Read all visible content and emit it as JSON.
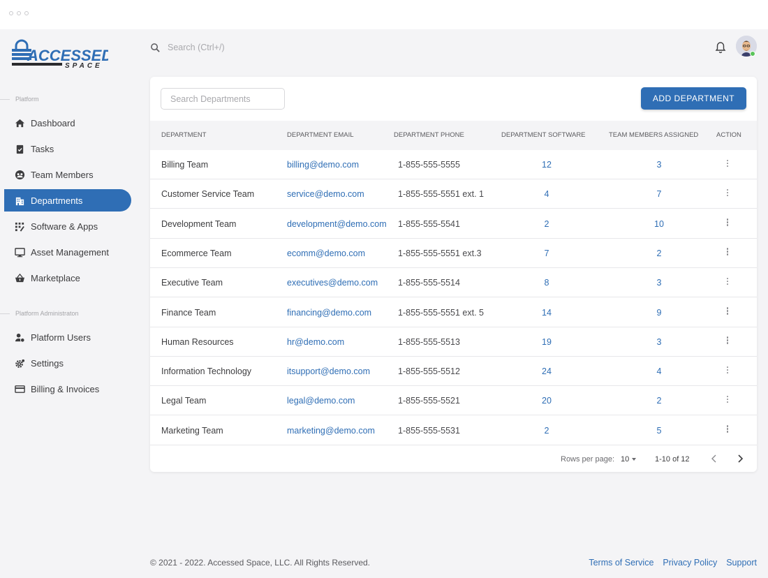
{
  "window": {
    "title": ""
  },
  "brand": {
    "name": "ACCESSED",
    "sub": "SPACE",
    "primary_color": "#2f6eb5",
    "dark_color": "#2b2b2e"
  },
  "sidebar": {
    "sections": [
      {
        "label": "Platform"
      },
      {
        "label": "Platform Administraton"
      }
    ],
    "items": [
      {
        "label": "Dashboard",
        "icon": "home-icon",
        "active": false
      },
      {
        "label": "Tasks",
        "icon": "clipboard-icon",
        "active": false
      },
      {
        "label": "Team Members",
        "icon": "team-icon",
        "active": false
      },
      {
        "label": "Departments",
        "icon": "building-icon",
        "active": true
      },
      {
        "label": "Software & Apps",
        "icon": "apps-grid-icon",
        "active": false
      },
      {
        "label": "Asset Management",
        "icon": "monitor-icon",
        "active": false
      },
      {
        "label": "Marketplace",
        "icon": "basket-icon",
        "active": false
      },
      {
        "label": "Platform Users",
        "icon": "users-shield-icon",
        "active": false
      },
      {
        "label": "Settings",
        "icon": "gear-icon",
        "active": false
      },
      {
        "label": "Billing & Invoices",
        "icon": "credit-card-icon",
        "active": false
      }
    ]
  },
  "header": {
    "search_placeholder": "Search (Ctrl+/)",
    "bell_icon": "bell-icon",
    "avatar_status_color": "#5bc45b"
  },
  "card": {
    "search_placeholder": "Search Departments",
    "add_button": "ADD DEPARTMENT",
    "columns": [
      "DEPARTMENT",
      "DEPARTMENT EMAIL",
      "DEPARTMENT PHONE",
      "DEPARTMENT SOFTWARE",
      "TEAM MEMBERS ASSIGNED",
      "ACTION"
    ],
    "rows": [
      {
        "name": "Billing Team",
        "email": "billing@demo.com",
        "phone": "1-855-555-5555",
        "software": "12",
        "members": "3"
      },
      {
        "name": "Customer Service Team",
        "email": "service@demo.com",
        "phone": "1-855-555-5551 ext. 1",
        "software": "4",
        "members": "7"
      },
      {
        "name": "Development Team",
        "email": "development@demo.com",
        "phone": "1-855-555-5541",
        "software": "2",
        "members": "10"
      },
      {
        "name": "Ecommerce Team",
        "email": "ecomm@demo.com",
        "phone": "1-855-555-5551 ext.3",
        "software": "7",
        "members": "2"
      },
      {
        "name": "Executive Team",
        "email": "executives@demo.com",
        "phone": "1-855-555-5514",
        "software": "8",
        "members": "3"
      },
      {
        "name": "Finance Team",
        "email": "financing@demo.com",
        "phone": "1-855-555-5551 ext. 5",
        "software": "14",
        "members": "9"
      },
      {
        "name": "Human Resources",
        "email": "hr@demo.com",
        "phone": "1-855-555-5513",
        "software": "19",
        "members": "3"
      },
      {
        "name": "Information Technology",
        "email": "itsupport@demo.com",
        "phone": "1-855-555-5512",
        "software": "24",
        "members": "4"
      },
      {
        "name": "Legal Team",
        "email": "legal@demo.com",
        "phone": "1-855-555-5521",
        "software": "20",
        "members": "2"
      },
      {
        "name": "Marketing Team",
        "email": "marketing@demo.com",
        "phone": "1-855-555-5531",
        "software": "2",
        "members": "5"
      }
    ],
    "pagination": {
      "rows_per_page_label": "Rows per page:",
      "rows_per_page": "10",
      "range": "1-10 of 12"
    }
  },
  "footer": {
    "copyright": "© 2021 - 2022. Accessed Space, LLC. All Rights Reserved.",
    "links": [
      "Terms of Service",
      "Privacy Policy",
      "Support"
    ]
  }
}
